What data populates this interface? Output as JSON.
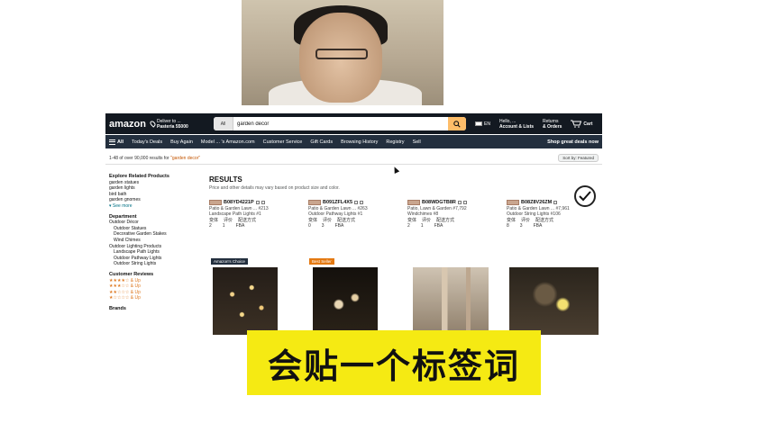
{
  "header": {
    "logo": "amazon",
    "deliver_line1": "Deliver to ...",
    "deliver_line2": "Pasteria 55000",
    "search_category": "All",
    "search_query": "garden decor",
    "lang": "EN",
    "account_line1": "Hello, ...",
    "account_line2": "Account & Lists",
    "returns_line1": "Returns",
    "returns_line2": "& Orders",
    "cart": "Cart"
  },
  "nav": {
    "all": "All",
    "items": [
      "Today's Deals",
      "Buy Again",
      "Model ... 's Amazon.com",
      "Customer Service",
      "Gift Cards",
      "Browsing History",
      "Registry",
      "Sell"
    ],
    "promo": "Shop great deals now"
  },
  "results_bar": {
    "text": "1-48 of over 90,000 results for",
    "query": "\"garden decor\"",
    "sort": "Sort by: Featured"
  },
  "sidebar": {
    "related_heading": "Explore Related Products",
    "related": [
      "garden statues",
      "garden lights",
      "bird bath",
      "garden gnomes"
    ],
    "see_more": "See more",
    "department_heading": "Department",
    "department_top": "Outdoor Décor",
    "department_sub": [
      "Outdoor Statues",
      "Decorative Garden Stakes",
      "Wind Chimes"
    ],
    "department_top2": "Outdoor Lighting Products",
    "department_sub2": [
      "Landscape Path Lights",
      "Outdoor Pathway Lights",
      "Outdoor String Lights"
    ],
    "reviews_heading": "Customer Reviews",
    "reviews": [
      "★★★★☆ & Up",
      "★★★☆☆ & Up",
      "★★☆☆☆ & Up",
      "★☆☆☆☆ & Up"
    ],
    "brands_heading": "Brands"
  },
  "results": {
    "heading": "RESULTS",
    "subheading": "Price and other details may vary based on product size and color."
  },
  "asins": [
    {
      "code": "B08YD4221P",
      "cat": "Patio & Garden Lawn ... #213",
      "sub": "Landscape Path Lights #1",
      "h1": "变体",
      "h2": "评价",
      "h3": "配送方式",
      "v1": "2",
      "v2": "1",
      "v3": "FBA"
    },
    {
      "code": "B091ZFL4X5",
      "cat": "Patio & Garden Lawn ... #263",
      "sub": "Outdoor Pathway Lights #1",
      "h1": "变体",
      "h2": "评价",
      "h3": "配送方式",
      "v1": "0",
      "v2": "3",
      "v3": "FBA"
    },
    {
      "code": "B08WDGTB8R",
      "cat": "Patio, Lawn & Garden #7,792",
      "sub": "Windchimes #8",
      "h1": "变体",
      "h2": "评价",
      "h3": "配送方式",
      "v1": "2",
      "v2": "1",
      "v3": "FBA"
    },
    {
      "code": "B08Z8V26ZM",
      "cat": "Patio & Garden Lawn ... #7,961",
      "sub": "Outdoor String Lights #106",
      "h1": "变体",
      "h2": "评价",
      "h3": "配送方式",
      "v1": "8",
      "v2": "3",
      "v3": "FBA"
    }
  ],
  "tile_badges": [
    "Amazon's Choice",
    "Best Seller"
  ],
  "subtitle": "会贴一个标签词"
}
